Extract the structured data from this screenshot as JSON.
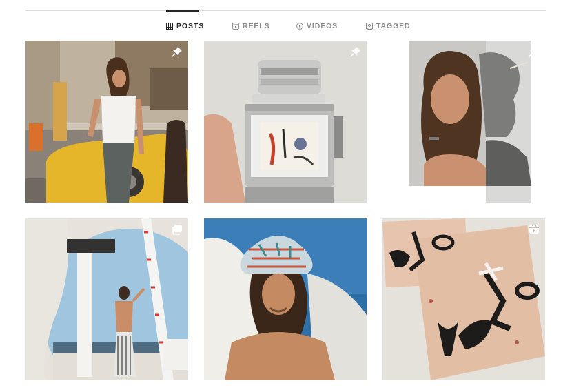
{
  "tabs": [
    {
      "label": "POSTS",
      "icon": "grid-icon",
      "active": true
    },
    {
      "label": "REELS",
      "icon": "reels-icon",
      "active": false
    },
    {
      "label": "VIDEOS",
      "icon": "play-circle-icon",
      "active": false
    },
    {
      "label": "TAGGED",
      "icon": "tagged-icon",
      "active": false
    }
  ],
  "posts": [
    {
      "subject": "street-portrait",
      "badge": "pin-icon"
    },
    {
      "subject": "camera-viewfinder",
      "badge": "pin-icon"
    },
    {
      "subject": "collage-portrait",
      "badge": "pin-icon"
    },
    {
      "subject": "mirror-shirtless",
      "badge": "carousel-icon"
    },
    {
      "subject": "bucket-hat-portrait",
      "badge": ""
    },
    {
      "subject": "abstract-paintings",
      "badge": "reel-icon"
    }
  ],
  "colors": {
    "active_text": "#262626",
    "inactive_text": "#8e8e8e",
    "divider": "#dbdbdb"
  }
}
